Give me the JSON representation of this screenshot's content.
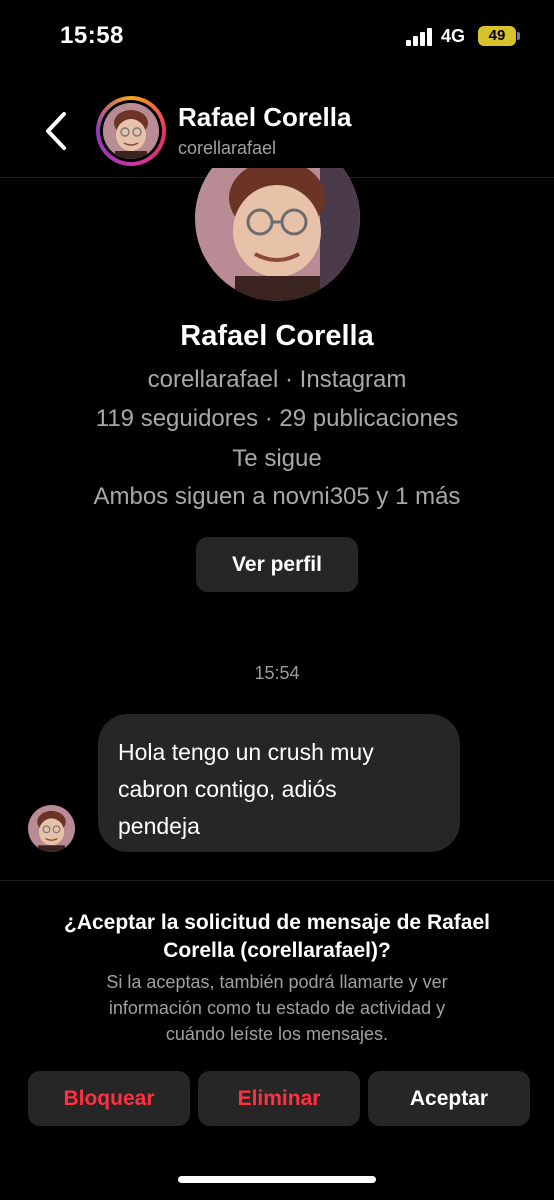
{
  "status_bar": {
    "time": "15:58",
    "network": "4G",
    "battery": "49"
  },
  "header": {
    "name": "Rafael Corella",
    "username": "corellarafael"
  },
  "profile": {
    "name": "Rafael Corella",
    "handle_line": "corellarafael · Instagram",
    "stats_line": "119 seguidores · 29 publicaciones",
    "follows_you": "Te sigue",
    "mutuals_line": "Ambos siguen a novni305 y 1 más",
    "view_profile_label": "Ver perfil"
  },
  "chat": {
    "timestamp": "15:54",
    "messages": [
      {
        "line1": "Hola tengo un crush muy",
        "line2": "cabron contigo, adiós",
        "line3": "pendeja"
      }
    ]
  },
  "request": {
    "title_line1": "¿Aceptar la solicitud de mensaje de Rafael",
    "title_line2": "Corella (corellarafael)?",
    "body_line1": "Si la aceptas, también podrá llamarte y ver",
    "body_line2": "información como tu estado de actividad y",
    "body_line3": "cuándo leíste los mensajes.",
    "block_label": "Bloquear",
    "delete_label": "Eliminar",
    "accept_label": "Aceptar"
  },
  "colors": {
    "background": "#000000",
    "surface": "#262626",
    "danger": "#ff3040",
    "secondary_text": "#a8a8a8",
    "battery": "#d8c12a"
  },
  "icons": [
    "back-chevron-icon",
    "signal-icon",
    "battery-icon"
  ]
}
